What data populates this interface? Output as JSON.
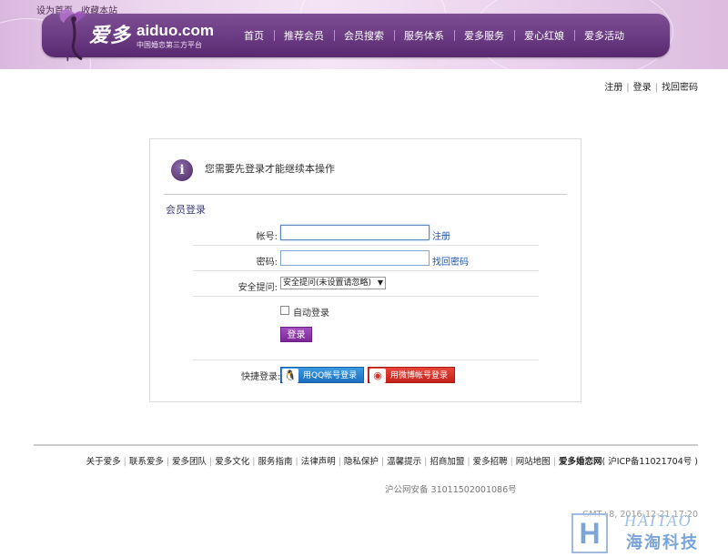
{
  "header": {
    "top_links": [
      "设为首页",
      "收藏本站"
    ],
    "logo": {
      "cn": "爱多",
      "en": "aiduo.com",
      "tagline": "中国婚恋第三方平台"
    },
    "nav": [
      "首页",
      "推荐会员",
      "会员搜索",
      "服务体系",
      "爱多服务",
      "爱心红娘",
      "爱多活动"
    ]
  },
  "account_links": {
    "register": "注册",
    "login": "登录",
    "recover": "找回密码"
  },
  "login_box": {
    "notice": "您需要先登录才能继续本操作",
    "section_title": "会员登录",
    "username": {
      "label": "帐号:",
      "value": "",
      "side_link": "注册"
    },
    "password": {
      "label": "密码:",
      "value": "",
      "side_link": "找回密码"
    },
    "security": {
      "label": "安全提问:",
      "selected": "安全提问(未设置请忽略)"
    },
    "auto_login": {
      "label": "自动登录",
      "checked": false
    },
    "submit": "登录",
    "quick_login": {
      "label": "快捷登录:",
      "qq": "用QQ帐号登录",
      "weibo": "用微博帐号登录"
    }
  },
  "footer": {
    "links": [
      "关于爱多",
      "联系爱多",
      "爱多团队",
      "爱多文化",
      "服务指南",
      "法律声明",
      "隐私保护",
      "温馨提示",
      "招商加盟",
      "爱多招聘",
      "网站地图"
    ],
    "site_name": "爱多婚恋网",
    "icp": "( 沪ICP备11021704号 )",
    "beian": "沪公网安备 31011502001086号",
    "gmt": "GMT+8, 2016-12-21 17:20"
  },
  "watermark": {
    "letter": "H",
    "en": "HAITAO",
    "cn": "海淘科技"
  },
  "colors": {
    "nav_purple": "#6a3a82",
    "button_purple": "#8a2fa6",
    "link_blue": "#1f55a8",
    "qq_blue": "#2a84d4",
    "weibo_red": "#d83228"
  }
}
